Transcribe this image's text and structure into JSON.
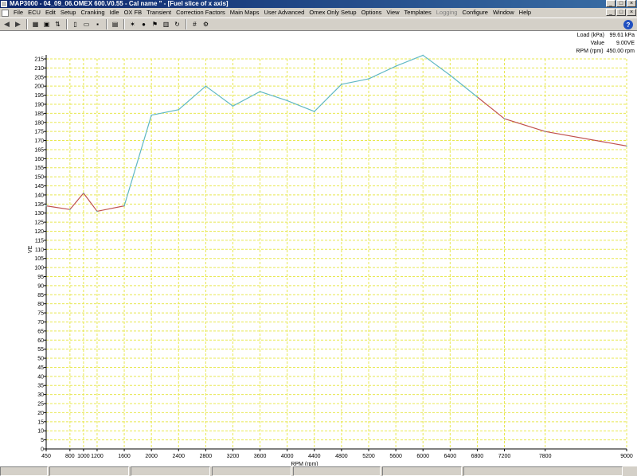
{
  "window": {
    "title": "MAP3000 - 04_09_06.OMEX 600.V0.55 - Cal name \" - [Fuel slice of x axis]",
    "minimize": "_",
    "maximize": "□",
    "close": "×"
  },
  "menu": {
    "items": [
      "File",
      "ECU",
      "Edit",
      "Setup",
      "Cranking",
      "Idle",
      "OX FB",
      "Transient",
      "Correction Factors",
      "Main Maps",
      "User Advanced",
      "Omex Only Setup",
      "Options",
      "View",
      "Templates",
      "Logging",
      "Configure",
      "Window",
      "Help"
    ],
    "disabled": [
      "Logging"
    ]
  },
  "toolbar": {
    "buttons": [
      {
        "name": "back-icon",
        "glyph": "◀"
      },
      {
        "name": "forward-icon",
        "glyph": "▶"
      },
      {
        "name": "sep"
      },
      {
        "name": "ecu-icon",
        "glyph": "▦"
      },
      {
        "name": "chip-icon",
        "glyph": "▣"
      },
      {
        "name": "connect-icon",
        "glyph": "⇅"
      },
      {
        "name": "sep"
      },
      {
        "name": "new-file-icon",
        "glyph": "▯"
      },
      {
        "name": "open-file-icon",
        "glyph": "▭"
      },
      {
        "name": "save-file-icon",
        "glyph": "▪"
      },
      {
        "name": "sep"
      },
      {
        "name": "table-icon",
        "glyph": "▤"
      },
      {
        "name": "sep"
      },
      {
        "name": "sun-icon",
        "glyph": "✶"
      },
      {
        "name": "stop-icon",
        "glyph": "●"
      },
      {
        "name": "flag-icon",
        "glyph": "⚑"
      },
      {
        "name": "graph-icon",
        "glyph": "▥"
      },
      {
        "name": "refresh-icon",
        "glyph": "↻"
      },
      {
        "name": "sep"
      },
      {
        "name": "grid-icon",
        "glyph": "#"
      },
      {
        "name": "tools-icon",
        "glyph": "⚙"
      }
    ],
    "help": "?"
  },
  "readout": {
    "load_label": "Load (kPa)",
    "load_value": "99.61 kPa",
    "value_label": "Value",
    "value_value": "9.00VE",
    "rpm_label": "RPM (rpm)",
    "rpm_value": "450.00 rpm"
  },
  "colors": {
    "trace_primary": "#5fb8c4",
    "trace_secondary": "#c0504d",
    "grid": "#e8e850",
    "axis": "#000000"
  },
  "chart_data": {
    "type": "line",
    "xlabel": "RPM (rpm)",
    "ylabel": "VE",
    "ylim": [
      0,
      215
    ],
    "y_ticks": [
      0,
      5,
      10,
      15,
      20,
      25,
      30,
      35,
      40,
      45,
      50,
      55,
      60,
      65,
      70,
      75,
      80,
      85,
      90,
      95,
      100,
      105,
      110,
      115,
      120,
      125,
      130,
      135,
      140,
      145,
      150,
      155,
      160,
      165,
      170,
      175,
      180,
      185,
      190,
      195,
      200,
      205,
      210,
      215
    ],
    "x_ticks": [
      450,
      800,
      1000,
      1200,
      1600,
      2000,
      2400,
      2800,
      3200,
      3600,
      4000,
      4400,
      4800,
      5200,
      5600,
      6000,
      6400,
      6800,
      7200,
      7800,
      9000
    ],
    "x_tick_labels": [
      "450",
      "800",
      "1000",
      "1200",
      "1600",
      "2000",
      "2400",
      "2800",
      "3200",
      "3600",
      "4000",
      "4400",
      "4800",
      "5200",
      "5600",
      "6000",
      "6400",
      "6800",
      "7200",
      "7800",
      "9000"
    ],
    "grid": true,
    "series": [
      {
        "x": [
          450,
          800,
          1000,
          1200,
          1600,
          2000,
          2400,
          2800,
          3200,
          3600,
          4000,
          4400,
          4800,
          5200,
          5600,
          6000,
          6400,
          6800,
          7200,
          7800,
          9000
        ],
        "y": [
          134,
          132,
          141,
          131,
          134,
          184,
          187,
          200,
          189,
          197,
          192,
          186,
          201,
          204,
          211,
          217,
          206,
          194,
          182,
          175,
          167
        ]
      }
    ]
  },
  "status": {
    "panels": [
      "",
      "",
      "",
      "",
      "",
      "",
      ""
    ]
  }
}
